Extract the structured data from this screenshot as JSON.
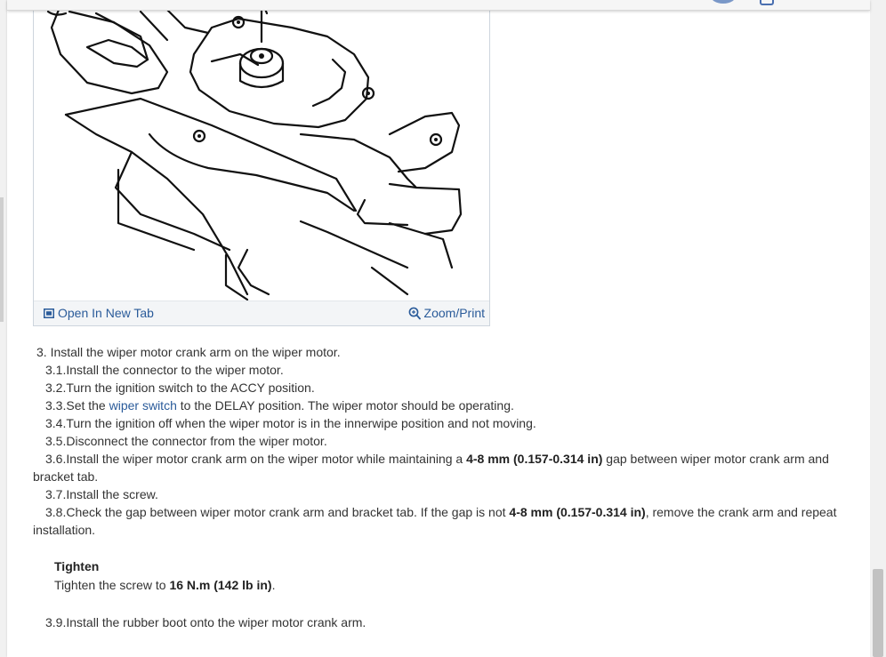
{
  "figure": {
    "open_new_tab": "Open In New Tab",
    "zoom_print": "Zoom/Print"
  },
  "steps": {
    "s3": "3. Install the wiper motor crank arm on the wiper motor.",
    "s3_1": "3.1.Install the connector to the wiper motor.",
    "s3_2": "3.2.Turn the ignition switch to the ACCY position.",
    "s3_3": {
      "pre": "3.3.Set the ",
      "link": "wiper switch",
      "post": " to the DELAY position. The wiper motor should be operating."
    },
    "s3_4": "3.4.Turn the ignition off when the wiper motor is in the innerwipe position and not moving.",
    "s3_5": "3.5.Disconnect the connector from the wiper motor.",
    "s3_6": {
      "pre": "3.6.Install the wiper motor crank arm on the wiper motor while maintaining a ",
      "bold": "4-8 mm (0.157-0.314 in)",
      "post": " gap between wiper motor crank arm and bracket tab."
    },
    "s3_7": "3.7.Install the screw.",
    "s3_8": {
      "pre": "3.8.Check the gap between wiper motor crank arm and bracket tab. If the gap is not ",
      "bold": "4-8 mm (0.157-0.314 in)",
      "post": ", remove the crank arm and repeat installation."
    },
    "tighten": {
      "heading": "Tighten",
      "pre": "Tighten the screw to ",
      "bold": "16 N.m (142 lb in)",
      "post": "."
    },
    "s3_9": "3.9.Install the rubber boot onto the wiper motor crank arm."
  }
}
